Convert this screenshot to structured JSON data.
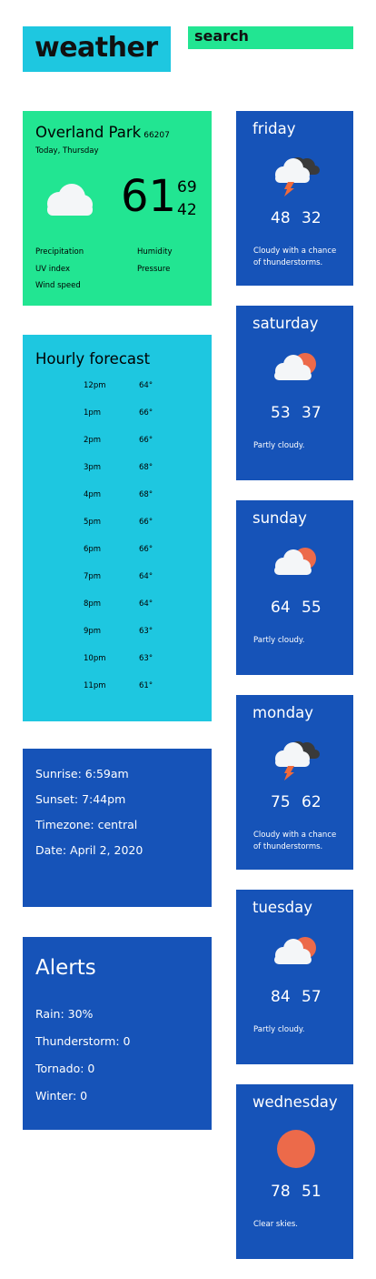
{
  "header": {
    "logo": "weather",
    "search": "search"
  },
  "today": {
    "city": "Overland Park",
    "zip": "66207",
    "subtitle": "Today, Thursday",
    "temp_now": "61",
    "temp_high": "69",
    "temp_low": "42",
    "icon": "cloud-icon",
    "stats": {
      "precipitation": "Precipitation",
      "humidity": "Humidity",
      "uv_index": "UV index",
      "pressure": "Pressure",
      "wind_speed": "Wind speed"
    }
  },
  "hourly": {
    "title": "Hourly forecast",
    "rows": [
      {
        "time": "12pm",
        "temp": "64°"
      },
      {
        "time": "1pm",
        "temp": "66°"
      },
      {
        "time": "2pm",
        "temp": "66°"
      },
      {
        "time": "3pm",
        "temp": "68°"
      },
      {
        "time": "4pm",
        "temp": "68°"
      },
      {
        "time": "5pm",
        "temp": "66°"
      },
      {
        "time": "6pm",
        "temp": "66°"
      },
      {
        "time": "7pm",
        "temp": "64°"
      },
      {
        "time": "8pm",
        "temp": "64°"
      },
      {
        "time": "9pm",
        "temp": "63°"
      },
      {
        "time": "10pm",
        "temp": "63°"
      },
      {
        "time": "11pm",
        "temp": "61°"
      }
    ]
  },
  "sun": {
    "sunrise": "Sunrise:  6:59am",
    "sunset": "Sunset:  7:44pm",
    "timezone": "Timezone:  central",
    "date": "Date:  April 2, 2020"
  },
  "alerts": {
    "title": "Alerts",
    "rain": "Rain:  30%",
    "thunderstorm": "Thunderstorm:  0",
    "tornado": "Tornado:  0",
    "winter": "Winter:  0"
  },
  "forecast": [
    {
      "day": "friday",
      "high": "48",
      "low": "32",
      "desc": "Cloudy with a chance of thunderstorms.",
      "icon": "thunderstorm-icon"
    },
    {
      "day": "saturday",
      "high": "53",
      "low": "37",
      "desc": "Partly cloudy.",
      "icon": "partly-cloudy-icon"
    },
    {
      "day": "sunday",
      "high": "64",
      "low": "55",
      "desc": "Partly cloudy.",
      "icon": "partly-cloudy-icon"
    },
    {
      "day": "monday",
      "high": "75",
      "low": "62",
      "desc": "Cloudy with a chance of thunderstorms.",
      "icon": "thunderstorm-icon"
    },
    {
      "day": "tuesday",
      "high": "84",
      "low": "57",
      "desc": "Partly cloudy.",
      "icon": "partly-cloudy-icon"
    },
    {
      "day": "wednesday",
      "high": "78",
      "low": "51",
      "desc": "Clear skies.",
      "icon": "sun-icon"
    }
  ],
  "colors": {
    "cyan": "#1ec7e0",
    "green": "#22e592",
    "blue": "#1653b8",
    "sun": "#ec6a4a",
    "dark_cloud": "#3a3a3a",
    "bolt": "#f26b3a"
  }
}
